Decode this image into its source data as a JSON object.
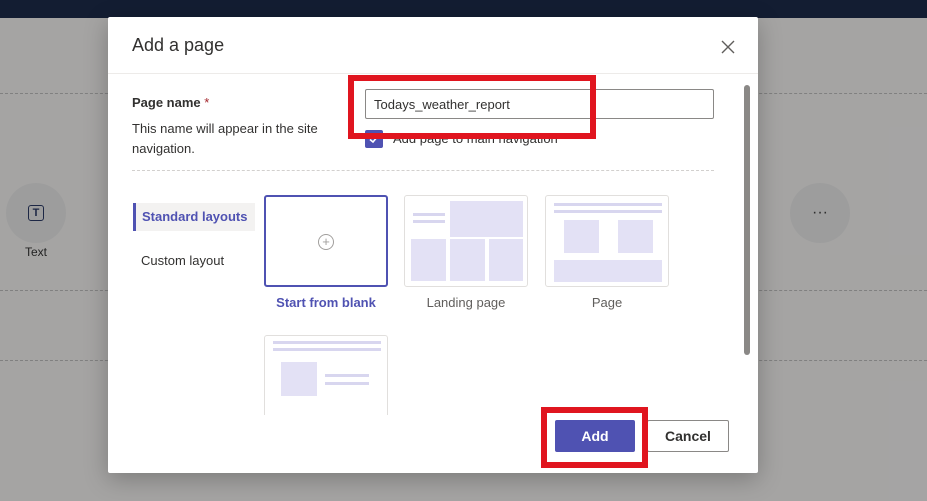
{
  "background": {
    "text_tool_label": "Text",
    "text_tool_glyph": "T",
    "more_icon": "more-horizontal-icon",
    "more_glyph": "···"
  },
  "dialog": {
    "title": "Add a page",
    "close_icon": "close-icon",
    "page_name": {
      "label": "Page name",
      "required_marker": "*",
      "help_text": "This name will appear in the site navigation.",
      "value": "Todays_weather_report"
    },
    "add_to_nav": {
      "label": "Add page to main navigation",
      "checked": true
    },
    "sidebar": {
      "items": [
        {
          "label": "Standard layouts",
          "selected": true
        },
        {
          "label": "Custom layout",
          "selected": false
        }
      ]
    },
    "layouts": [
      {
        "label": "Start from blank",
        "selected": true
      },
      {
        "label": "Landing page",
        "selected": false
      },
      {
        "label": "Page",
        "selected": false
      }
    ],
    "buttons": {
      "add_label": "Add",
      "cancel_label": "Cancel"
    }
  },
  "colors": {
    "accent": "#4f52b2",
    "highlight": "#e0151f",
    "top_bar": "#1c2b4b"
  }
}
